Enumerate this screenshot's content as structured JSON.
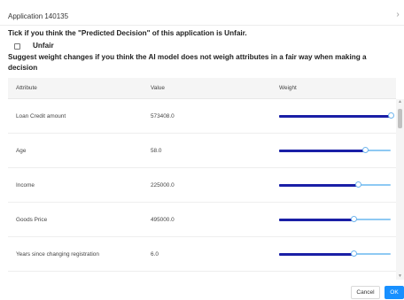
{
  "dialog": {
    "title": "Application 140135",
    "close_icon": "close-icon"
  },
  "form": {
    "question": "Tick if you think the \"Predicted Decision\" of this application is Unfair.",
    "checkbox_label": "Unfair",
    "checkbox_checked": false,
    "suggest_text": "Suggest weight changes if you think the AI model does not weigh attributes in a fair way when making a decision"
  },
  "table": {
    "headers": {
      "attribute": "Attribute",
      "value": "Value",
      "weight": "Weight"
    },
    "rows": [
      {
        "attribute": "Loan Credit amount",
        "value": "573408.0",
        "weight_fraction": 1.0
      },
      {
        "attribute": "Age",
        "value": "58.0",
        "weight_fraction": 0.77
      },
      {
        "attribute": "Income",
        "value": "225000.0",
        "weight_fraction": 0.71
      },
      {
        "attribute": "Goods Price",
        "value": "495000.0",
        "weight_fraction": 0.67
      },
      {
        "attribute": "Years since changing registration",
        "value": "6.0",
        "weight_fraction": 0.67
      }
    ]
  },
  "colors": {
    "slider_fill": "#1a1fa6",
    "slider_rest": "#8ec9f3",
    "primary_button": "#1890ff"
  },
  "footer": {
    "cancel_label": "Cancel",
    "ok_label": "OK"
  }
}
